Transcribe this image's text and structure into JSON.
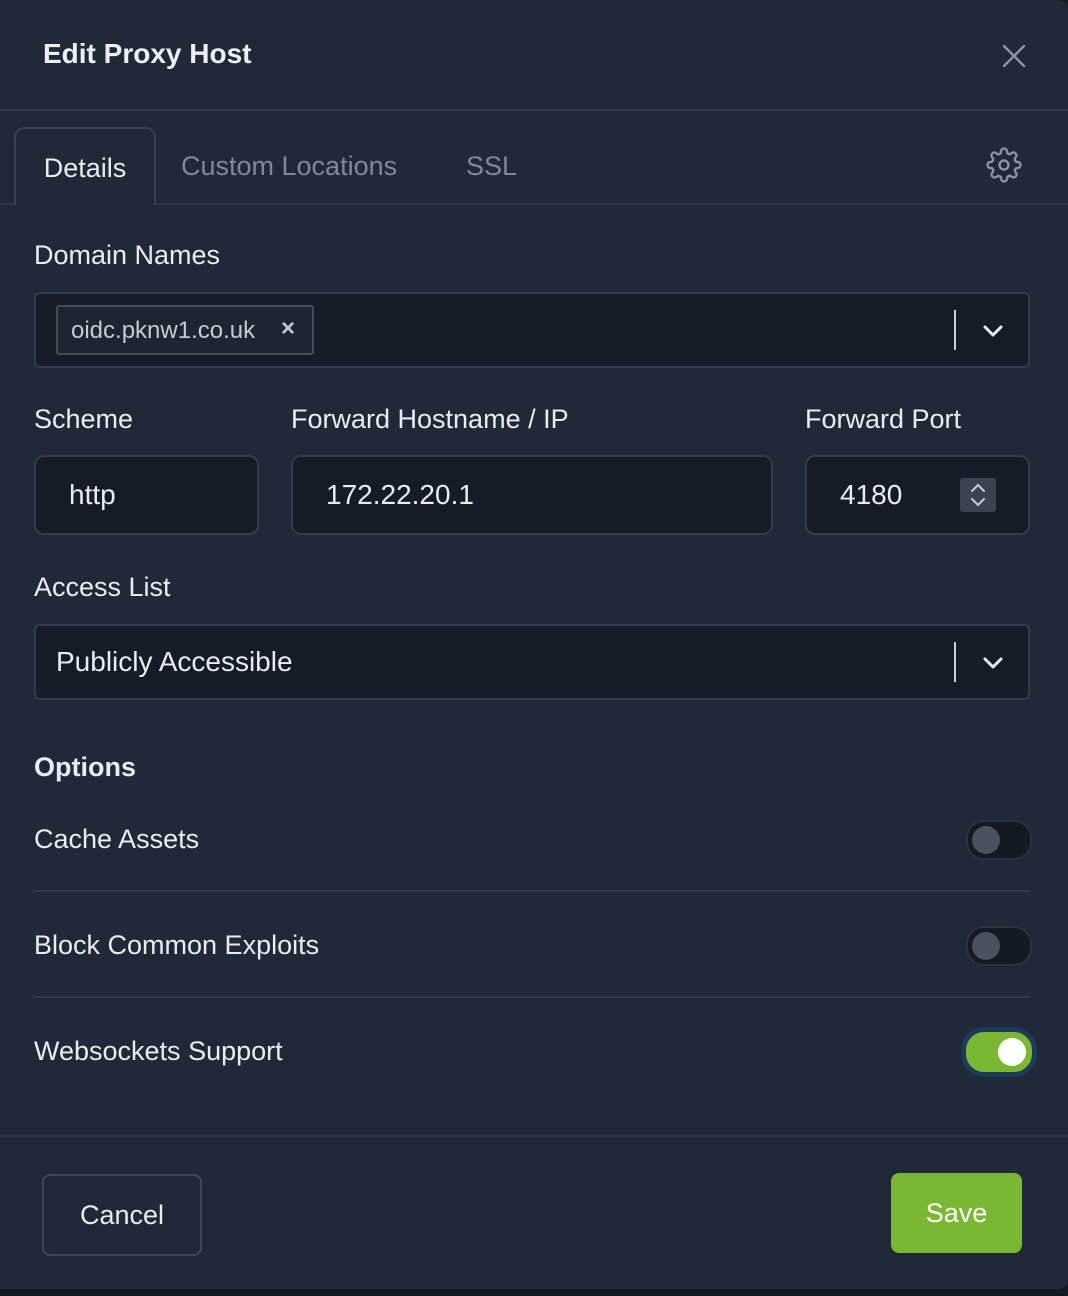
{
  "modal": {
    "title": "Edit Proxy Host",
    "close_icon": "close-icon"
  },
  "tabs": [
    {
      "label": "Details",
      "active": true
    },
    {
      "label": "Custom Locations",
      "active": false
    },
    {
      "label": "SSL",
      "active": false
    }
  ],
  "settings_icon": "gear-icon",
  "domain_names": {
    "label": "Domain Names",
    "chips": [
      {
        "text": "oidc.pknw1.co.uk",
        "remove": "×"
      }
    ]
  },
  "scheme": {
    "label": "Scheme",
    "value": "http"
  },
  "forward_host": {
    "label": "Forward Hostname / IP",
    "value": "172.22.20.1"
  },
  "forward_port": {
    "label": "Forward Port",
    "value": "4180"
  },
  "access_list": {
    "label": "Access List",
    "value": "Publicly Accessible"
  },
  "options": {
    "heading": "Options",
    "items": [
      {
        "label": "Cache Assets",
        "enabled": false
      },
      {
        "label": "Block Common Exploits",
        "enabled": false
      },
      {
        "label": "Websockets Support",
        "enabled": true
      }
    ]
  },
  "footer": {
    "cancel_label": "Cancel",
    "save_label": "Save"
  },
  "colors": {
    "accent": "#7ab733",
    "background": "#1f2938",
    "input_bg": "#151c28"
  }
}
